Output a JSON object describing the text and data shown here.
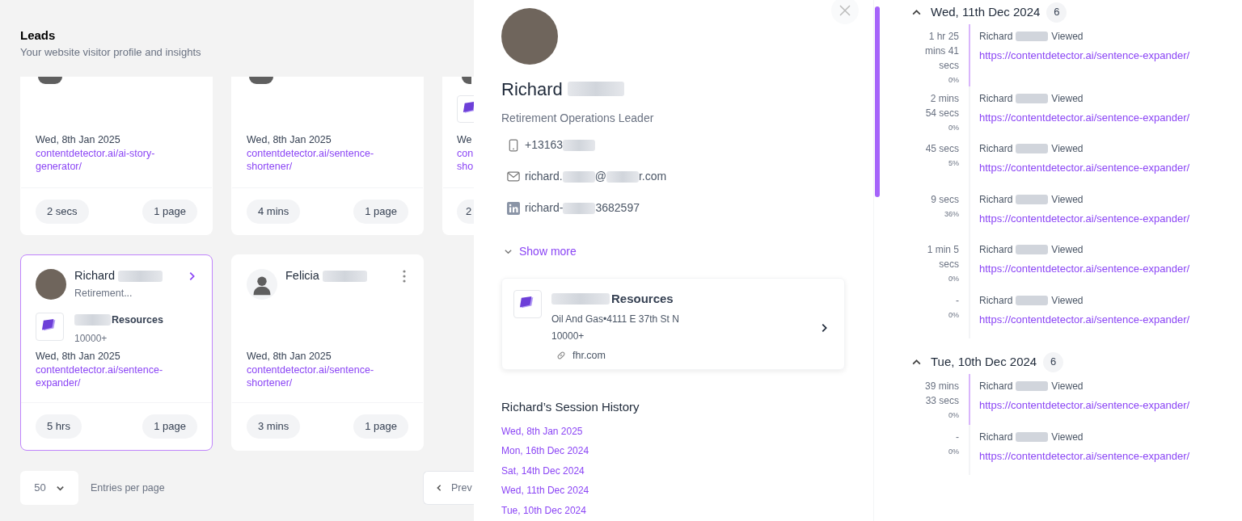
{
  "page": {
    "title": "Leads",
    "subtitle": "Your website visitor profile and insights"
  },
  "lead_cards": [
    {
      "kind": "cut_top",
      "selected": false,
      "date": "Wed, 8th Jan 2025",
      "url": "contentdetector.ai/ai-story-generator/",
      "duration": "2 secs",
      "pages": "1 page"
    },
    {
      "kind": "cut_top",
      "selected": false,
      "date": "Wed, 8th Jan 2025",
      "url": "contentdetector.ai/sentence-shortener/",
      "duration": "4 mins",
      "pages": "1 page"
    },
    {
      "kind": "cut_side",
      "selected": false,
      "date": "We",
      "url_lines": [
        "con",
        "sho"
      ],
      "duration": "2"
    },
    {
      "kind": "full",
      "selected": true,
      "has_photo": true,
      "name_parts": [
        {
          "kind": "text",
          "text": "Richard"
        },
        {
          "kind": "blur"
        }
      ],
      "title": "Retirement...",
      "company": {
        "name_parts": [
          {
            "kind": "blur"
          },
          {
            "kind": "text",
            "text": "Resources"
          }
        ],
        "size": "10000+"
      },
      "date": "Wed, 8th Jan 2025",
      "url": "contentdetector.ai/sentence-expander/",
      "duration": "5 hrs",
      "pages": "1 page"
    },
    {
      "kind": "full",
      "selected": false,
      "has_photo": false,
      "name_parts": [
        {
          "kind": "text",
          "text": "Felicia"
        },
        {
          "kind": "blur"
        }
      ],
      "date": "Wed, 8th Jan 2025",
      "url": "contentdetector.ai/sentence-shortener/",
      "duration": "3 mins",
      "pages": "1 page"
    }
  ],
  "pagination": {
    "per_page": "50",
    "per_page_label": "Entries per page",
    "prev_label": "Prev"
  },
  "profile": {
    "name_parts": [
      {
        "kind": "text",
        "text": "Richard"
      },
      {
        "kind": "blur"
      }
    ],
    "title": "Retirement Operations Leader",
    "contacts": [
      {
        "kind": "phone",
        "parts": [
          {
            "kind": "text",
            "text": "+13163"
          },
          {
            "kind": "blur"
          }
        ]
      },
      {
        "kind": "email",
        "parts": [
          {
            "kind": "text",
            "text": "richard."
          },
          {
            "kind": "blur"
          },
          {
            "kind": "text",
            "text": "@"
          },
          {
            "kind": "blur"
          },
          {
            "kind": "text",
            "text": "r.com"
          }
        ]
      },
      {
        "kind": "linkedin",
        "parts": [
          {
            "kind": "text",
            "text": "richard-"
          },
          {
            "kind": "blur"
          },
          {
            "kind": "text",
            "text": "3682597"
          }
        ]
      }
    ],
    "show_more": "Show more",
    "company": {
      "name_parts": [
        {
          "kind": "blur"
        },
        {
          "kind": "text",
          "text": "Resources"
        }
      ],
      "details": "Oil And Gas•4111 E 37th St N",
      "size": "10000+",
      "website": "fhr.com"
    },
    "session_history_title": "Richard’s Session History",
    "session_dates": [
      "Wed, 8th Jan 2025",
      "Mon, 16th Dec 2024",
      "Sat, 14th Dec 2024",
      "Wed, 11th Dec 2024",
      "Tue, 10th Dec 2024"
    ]
  },
  "timeline": [
    {
      "date": "Wed, 11th Dec 2024",
      "count": "6",
      "expanded": true,
      "entries": [
        {
          "duration": "1 hr 25 mins 41 secs",
          "percent": "0%",
          "highlighted": true,
          "viewer": "Richard",
          "action": "Viewed",
          "url": "https://contentdetector.ai/sentence-expander/"
        },
        {
          "duration": "2 mins 54 secs",
          "percent": "0%",
          "highlighted": false,
          "viewer": "Richard",
          "action": "Viewed",
          "url": "https://contentdetector.ai/sentence-expander/"
        },
        {
          "duration": "45 secs",
          "percent": "5%",
          "highlighted": false,
          "viewer": "Richard",
          "action": "Viewed",
          "url": "https://contentdetector.ai/sentence-expander/"
        },
        {
          "duration": "9 secs",
          "percent": "36%",
          "highlighted": false,
          "viewer": "Richard",
          "action": "Viewed",
          "url": "https://contentdetector.ai/sentence-expander/"
        },
        {
          "duration": "1 min 5 secs",
          "percent": "0%",
          "highlighted": false,
          "viewer": "Richard",
          "action": "Viewed",
          "url": "https://contentdetector.ai/sentence-expander/"
        },
        {
          "duration": "-",
          "percent": "0%",
          "highlighted": false,
          "viewer": "Richard",
          "action": "Viewed",
          "url": "https://contentdetector.ai/sentence-expander/"
        }
      ]
    },
    {
      "date": "Tue, 10th Dec 2024",
      "count": "6",
      "expanded": true,
      "entries": [
        {
          "duration": "39 mins 33 secs",
          "percent": "0%",
          "highlighted": true,
          "viewer": "Richard",
          "action": "Viewed",
          "url": "https://contentdetector.ai/sentence-expander/"
        },
        {
          "duration": "-",
          "percent": "0%",
          "highlighted": false,
          "viewer": "Richard",
          "action": "Viewed",
          "url": "https://contentdetector.ai/sentence-expander/"
        }
      ]
    }
  ]
}
